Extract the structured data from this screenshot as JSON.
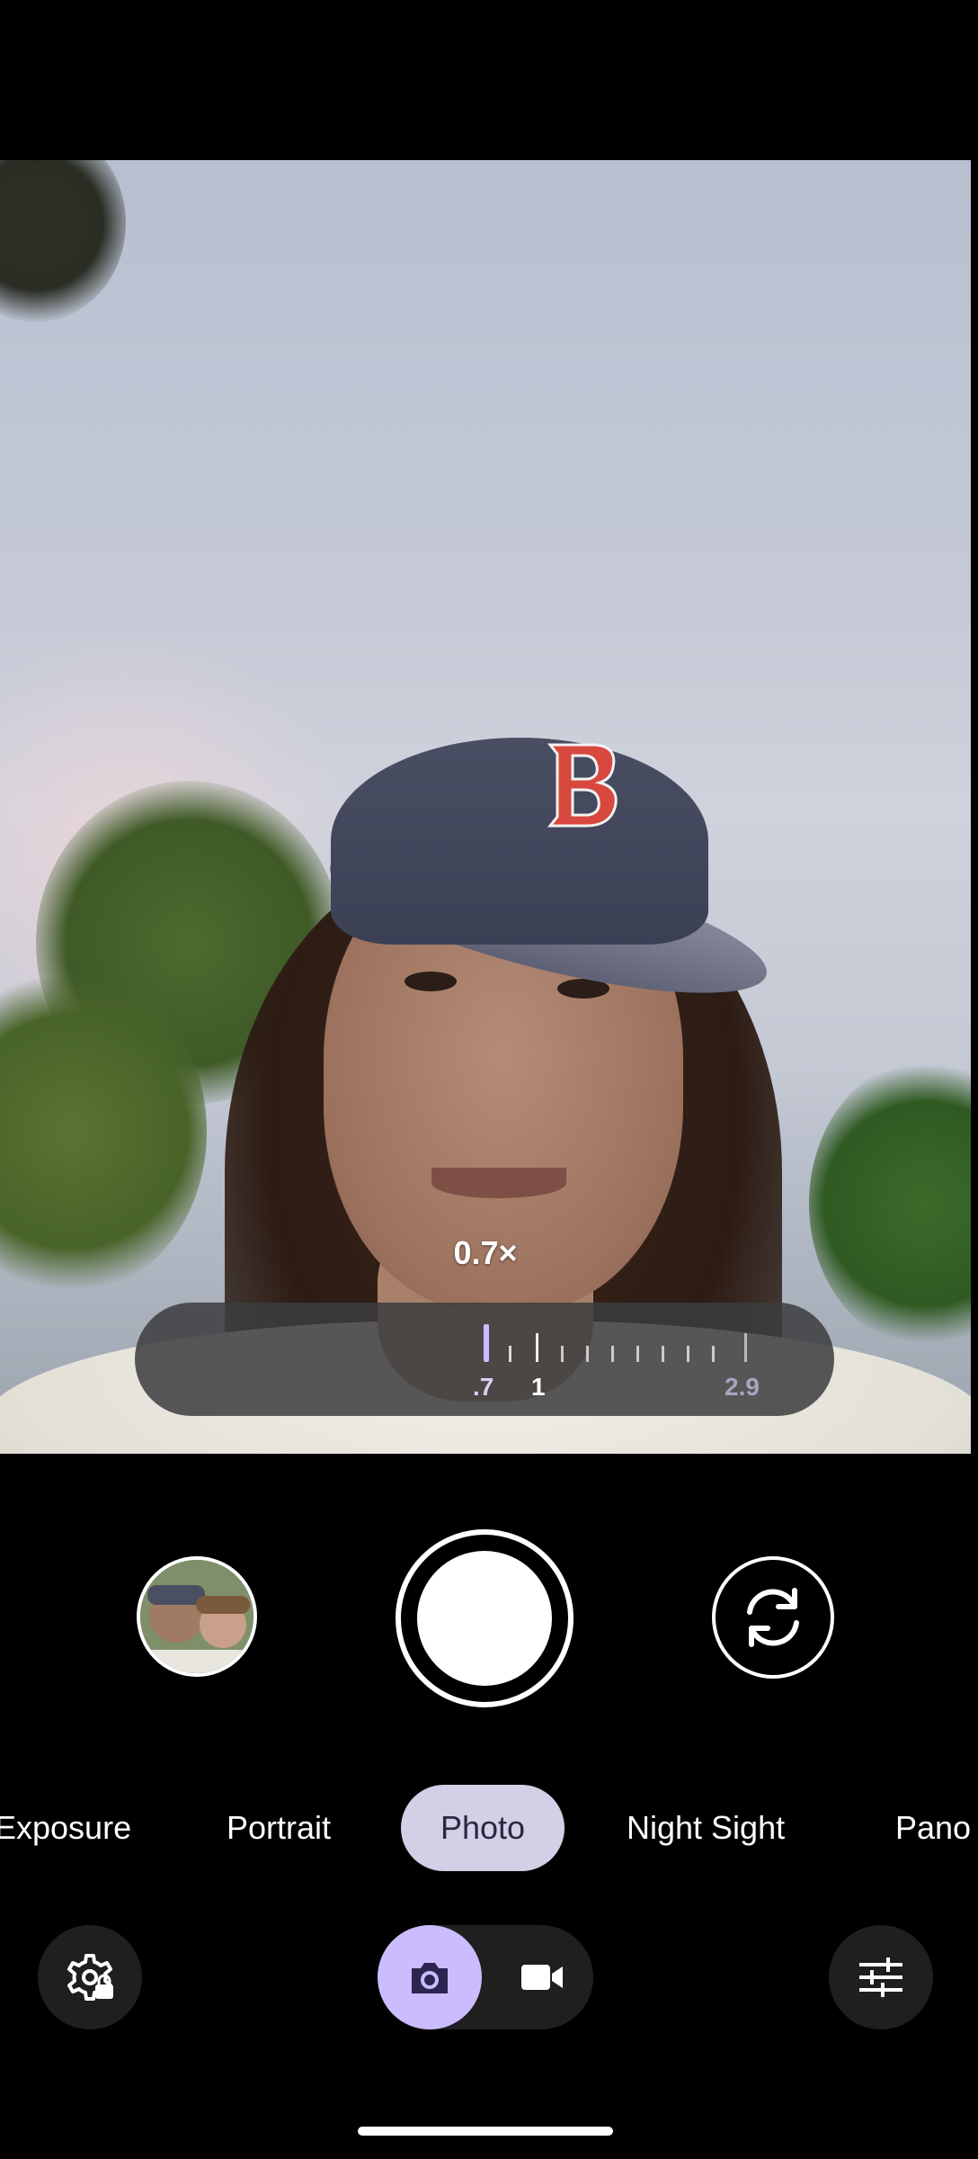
{
  "zoom": {
    "current_label": "0.7×",
    "scale_labels": [
      ".7",
      "1",
      "2.9"
    ],
    "level": 0.7
  },
  "modes": {
    "items": [
      "Exposure",
      "Portrait",
      "Photo",
      "Night Sight",
      "Pano"
    ],
    "selected": "Photo"
  },
  "capture_toggle": {
    "selected": "photo"
  },
  "icons": {
    "settings": "settings-gear-lock-icon",
    "photo": "camera-icon",
    "video": "videocam-icon",
    "flip": "flip-camera-icon",
    "adjust": "sliders-icon"
  },
  "colors": {
    "accent": "#cbbcff",
    "mode_selected_bg": "#d3cfe6",
    "zoom_text": "#d6d0f2"
  }
}
